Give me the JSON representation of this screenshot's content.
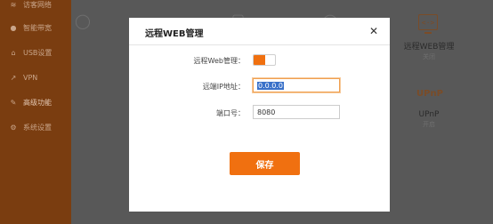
{
  "sidebar": {
    "items": [
      {
        "label": "访客网络",
        "icon": "wifi-icon"
      },
      {
        "label": "智能带宽",
        "icon": "location-pin-icon"
      },
      {
        "label": "USB设置",
        "icon": "usb-icon"
      },
      {
        "label": "VPN",
        "icon": "arrow-icon"
      },
      {
        "label": "高级功能",
        "icon": "wrench-icon"
      },
      {
        "label": "系统设置",
        "icon": "gear-icon"
      }
    ]
  },
  "background": {
    "features": [
      {
        "title": "远程WEB管理",
        "status": "关闭"
      },
      {
        "title": "UPnP",
        "status": "开启"
      }
    ],
    "upnp_icon_text": "UPnP",
    "web_icon_text": "<·>"
  },
  "modal": {
    "title": "远程WEB管理",
    "close_symbol": "✕",
    "web_label": "远程Web管理：",
    "web_enabled": true,
    "ip_label": "远端IP地址：",
    "ip_value": "0.0.0.0",
    "port_label": "端口号：",
    "port_value": "8080",
    "save_label": "保存"
  },
  "colors": {
    "accent": "#f07010",
    "sidebar": "#7a3d10",
    "overlay": "#575757"
  }
}
